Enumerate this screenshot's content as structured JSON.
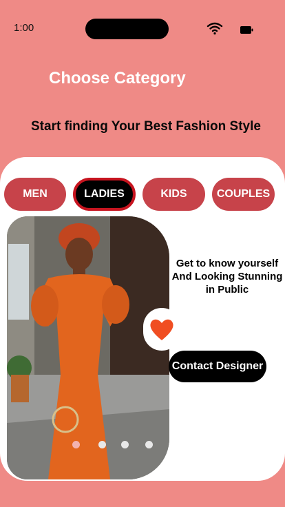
{
  "status_bar": {
    "time": "1:00",
    "wifi_icon": "wifi-icon",
    "battery_icon": "battery-icon"
  },
  "header": {
    "title": "Choose Category",
    "subtitle": "Start finding Your Best Fashion Style"
  },
  "categories": [
    {
      "label": "MEN",
      "active": false
    },
    {
      "label": "LADIES",
      "active": true
    },
    {
      "label": "KIDS",
      "active": false
    },
    {
      "label": "COUPLES",
      "active": false
    }
  ],
  "carousel": {
    "slide_count": 4,
    "active_index": 0
  },
  "favorite": {
    "icon": "heart-icon",
    "color": "#F04E22"
  },
  "promo": {
    "tagline": "Get to know yourself And Looking Stunning in Public",
    "contact_label": "Contact Designer"
  },
  "colors": {
    "background": "#EF8A86",
    "accent": "#C7434A",
    "active_border": "#C7141F"
  }
}
